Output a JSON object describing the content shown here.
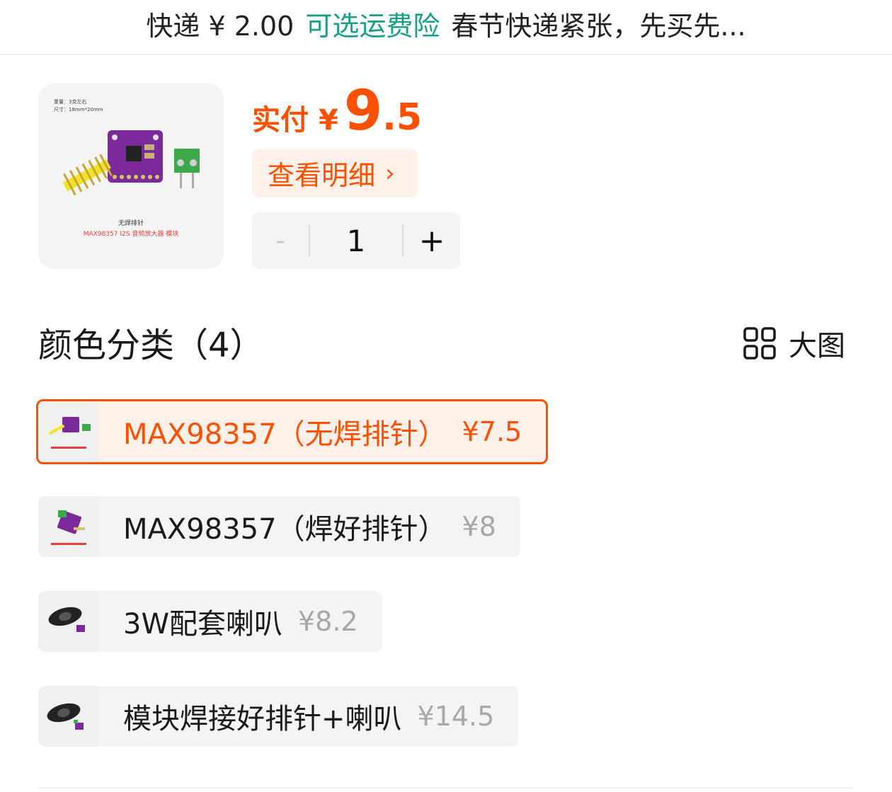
{
  "shipping": {
    "prefix": "快递 ¥ 2.00",
    "insurance_link": "可选运费险",
    "note": "春节快递紧张，先买先..."
  },
  "product": {
    "image_caption_1": "无焊排针",
    "image_caption_2": "MAX98357 I2S 音频放大器 模块",
    "image_spec_1": "重量：3克左右",
    "image_spec_2": "尺寸：18mm*20mm"
  },
  "price": {
    "label": "实付",
    "currency": "¥",
    "integer": "9",
    "decimal": ".5",
    "color": "#ff5000"
  },
  "detail_button": {
    "label": "查看明细",
    "chevron": "›"
  },
  "quantity": {
    "minus": "-",
    "value": "1",
    "plus": "+"
  },
  "section": {
    "title": "颜色分类（4）",
    "big_view_label": "大图",
    "big_view_icon": "grid-icon"
  },
  "variants": [
    {
      "label": "MAX98357（无焊排针）",
      "price": "¥7.5",
      "selected": true
    },
    {
      "label": "MAX98357（焊好排针）",
      "price": "¥8",
      "selected": false
    },
    {
      "label": "3W配套喇叭",
      "price": "¥8.2",
      "selected": false
    },
    {
      "label": "模块焊接好排针+喇叭",
      "price": "¥14.5",
      "selected": false
    }
  ],
  "colors": {
    "accent": "#ff5000",
    "insurance": "#16a085",
    "muted_price": "#a8a8a8",
    "chip_bg": "#f4f4f4"
  }
}
